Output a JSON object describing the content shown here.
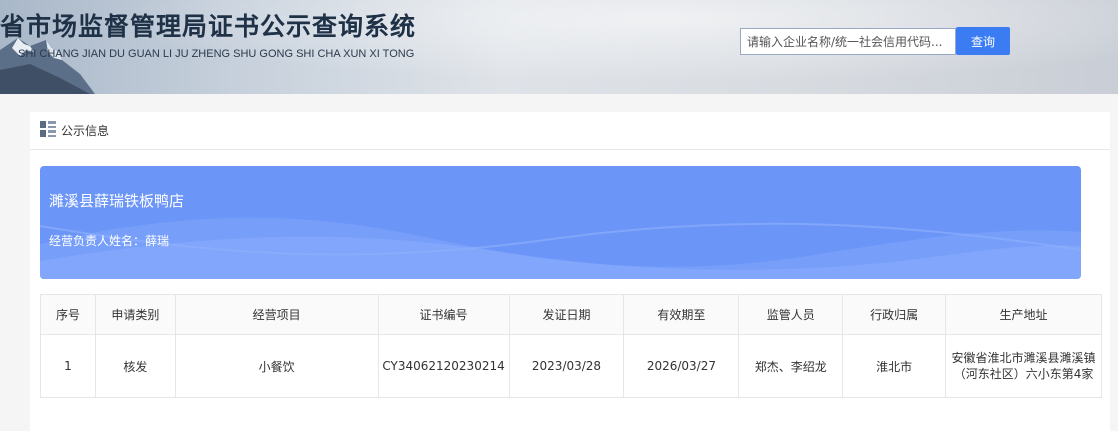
{
  "header": {
    "title": "省市场监督管理局证书公示查询系统",
    "subtitle": "SHI CHANG JIAN DU GUAN LI JU ZHENG SHU GONG SHI CHA XUN XI TONG",
    "search_placeholder": "请输入企业名称/统一社会信用代码...",
    "search_button": "查询"
  },
  "panel": {
    "title": "公示信息",
    "icon": "list-icon"
  },
  "banner": {
    "company": "濉溪县薛瑞铁板鸭店",
    "person": "经营负责人姓名：薛瑞",
    "color": "#6b96f8"
  },
  "table": {
    "headers": [
      "序号",
      "申请类别",
      "经营项目",
      "证书编号",
      "发证日期",
      "有效期至",
      "监管人员",
      "行政归属",
      "生产地址"
    ],
    "rows": [
      [
        "1",
        "核发",
        "小餐饮",
        "CY34062120230214",
        "2023/03/28",
        "2026/03/27",
        "郑杰、李绍龙",
        "淮北市",
        "安徽省淮北市濉溪县濉溪镇（河东社区）六小东第4家"
      ]
    ]
  },
  "colors": {
    "accent": "#3c7cf2",
    "title": "#1f3147"
  }
}
